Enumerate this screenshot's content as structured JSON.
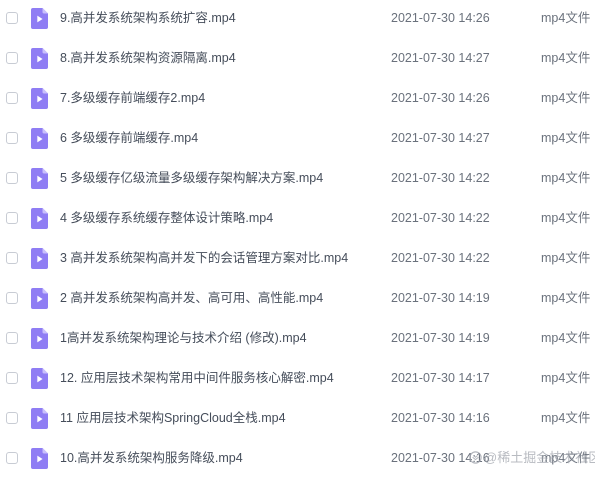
{
  "colors": {
    "icon_body": "#8f7df4",
    "icon_fold": "#c9c0fb",
    "checkbox_border": "#c8ccd4",
    "text_primary": "#454d5a",
    "text_secondary": "#6a717c"
  },
  "file_icon": "video-file-icon",
  "files": [
    {
      "name": "9.高并发系统架构系统扩容.mp4",
      "modified": "2021-07-30 14:26",
      "type": "mp4文件"
    },
    {
      "name": "8.高并发系统架构资源隔离.mp4",
      "modified": "2021-07-30 14:27",
      "type": "mp4文件"
    },
    {
      "name": "7.多级缓存前端缓存2.mp4",
      "modified": "2021-07-30 14:26",
      "type": "mp4文件"
    },
    {
      "name": "6 多级缓存前端缓存.mp4",
      "modified": "2021-07-30 14:27",
      "type": "mp4文件"
    },
    {
      "name": "5 多级缓存亿级流量多级缓存架构解决方案.mp4",
      "modified": "2021-07-30 14:22",
      "type": "mp4文件"
    },
    {
      "name": "4 多级缓存系统缓存整体设计策略.mp4",
      "modified": "2021-07-30 14:22",
      "type": "mp4文件"
    },
    {
      "name": "3 高并发系统架构高并发下的会话管理方案对比.mp4",
      "modified": "2021-07-30 14:22",
      "type": "mp4文件"
    },
    {
      "name": "2 高并发系统架构高并发、高可用、高性能.mp4",
      "modified": "2021-07-30 14:19",
      "type": "mp4文件"
    },
    {
      "name": "1高并发系统架构理论与技术介绍 (修改).mp4",
      "modified": "2021-07-30 14:19",
      "type": "mp4文件"
    },
    {
      "name": "12. 应用层技术架构常用中间件服务核心解密.mp4",
      "modified": "2021-07-30 14:17",
      "type": "mp4文件"
    },
    {
      "name": "11 应用层技术架构SpringCloud全栈.mp4",
      "modified": "2021-07-30 14:16",
      "type": "mp4文件"
    },
    {
      "name": "10.高并发系统架构服务降级.mp4",
      "modified": "2021-07-30 14:16",
      "type": "mp4文件"
    }
  ],
  "watermark": {
    "text": "@稀土掘金技术社区",
    "icon": "juejin-logo-icon"
  }
}
